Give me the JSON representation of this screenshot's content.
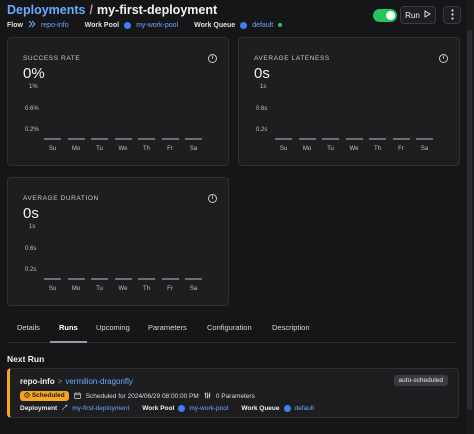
{
  "header": {
    "breadcrumb_root": "Deployments",
    "breadcrumb_sep": "/",
    "breadcrumb_current": "my-first-deployment",
    "flow_label": "Flow",
    "flow_value": "repo-info",
    "work_pool_label": "Work Pool",
    "work_pool_value": "my-work-pool",
    "work_queue_label": "Work Queue",
    "work_queue_value": "default",
    "run_label": "Run",
    "toggle_on": true
  },
  "days": [
    "Su",
    "Mo",
    "Tu",
    "We",
    "Th",
    "Fr",
    "Sa"
  ],
  "cards": {
    "success_rate": {
      "title": "SUCCESS RATE",
      "value": "0%",
      "y_ticks": [
        "1%",
        "0.6%",
        "0.2%"
      ]
    },
    "average_lateness": {
      "title": "AVERAGE LATENESS",
      "value": "0s",
      "y_ticks": [
        "1s",
        "0.6s",
        "0.2s"
      ]
    },
    "average_duration": {
      "title": "AVERAGE DURATION",
      "value": "0s",
      "y_ticks": [
        "1s",
        "0.6s",
        "0.2s"
      ]
    }
  },
  "tabs": [
    "Details",
    "Runs",
    "Upcoming",
    "Parameters",
    "Configuration",
    "Description"
  ],
  "active_tab": "Runs",
  "next_run": {
    "heading": "Next Run",
    "flow": "repo-info",
    "chevron": ">",
    "run_name": "vermilion-dragonfly",
    "badge": "auto-scheduled",
    "state": "Scheduled",
    "scheduled_text": "Scheduled for 2024/06/29 08:00:00 PM",
    "parameters": "0 Parameters",
    "deployment_label": "Deployment",
    "deployment_value": "my-first-deployment",
    "work_pool_label": "Work Pool",
    "work_pool_value": "my-work-pool",
    "work_queue_label": "Work Queue",
    "work_queue_value": "default"
  },
  "colors": {
    "accent": "#6aa9ff",
    "scheduled": "#f5a623",
    "toggle": "#22c55e"
  }
}
